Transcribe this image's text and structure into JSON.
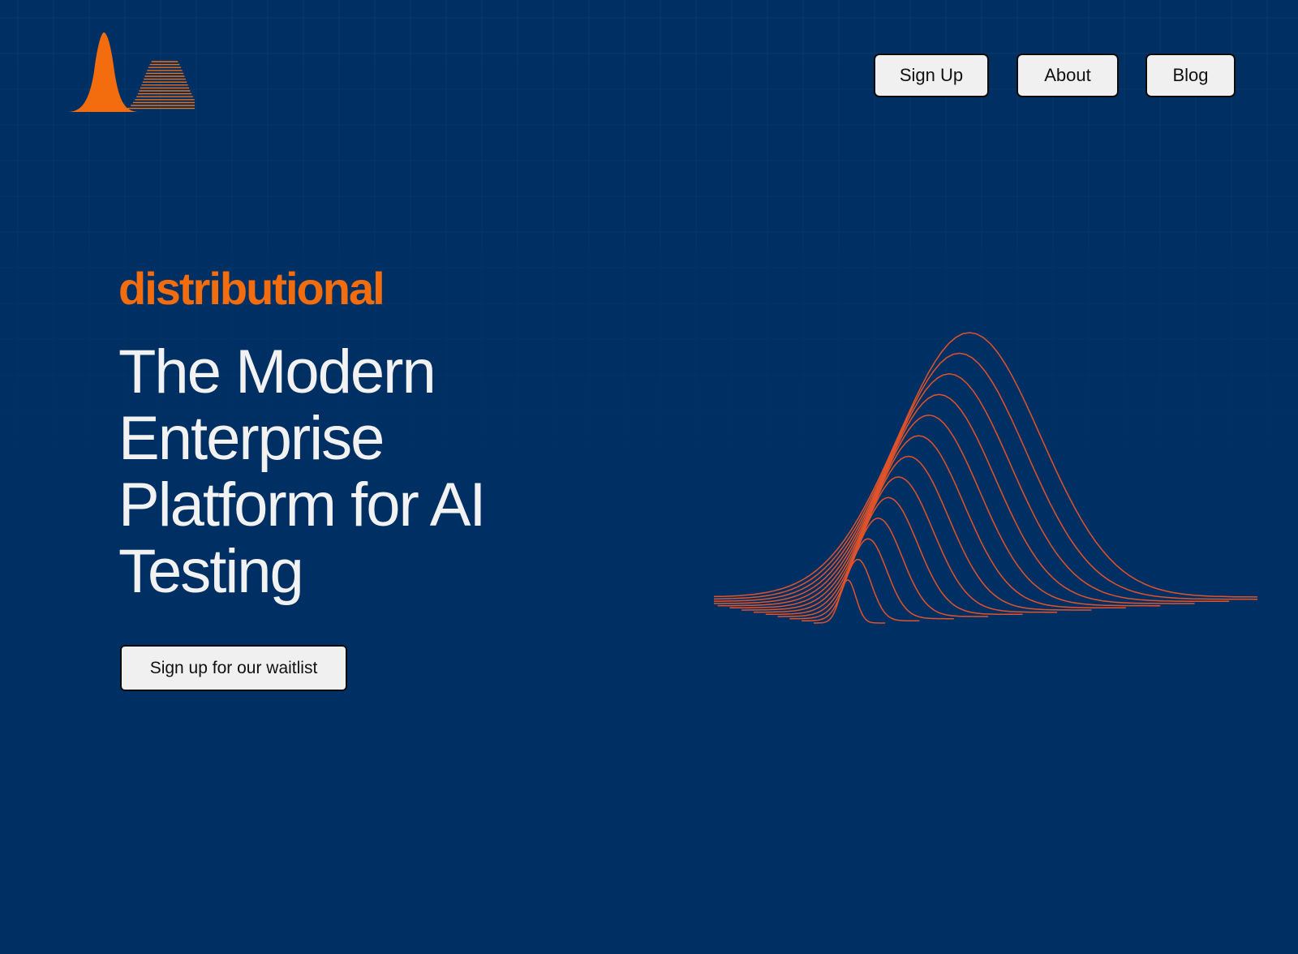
{
  "colors": {
    "background": "#003063",
    "accent": "#f36d0e",
    "wave_stroke": "#e0532a",
    "button_bg": "#f0f0f0",
    "headline_text": "#f2f2f2"
  },
  "header": {
    "logo_icon": "bell-curve-logo-icon",
    "nav": {
      "signup_label": "Sign Up",
      "about_label": "About",
      "blog_label": "Blog"
    }
  },
  "hero": {
    "brand": "distributional",
    "headline": "The Modern Enterprise Platform for AI Testing",
    "cta_label": "Sign up for our waitlist",
    "illustration_icon": "stacked-bell-curves-icon"
  }
}
